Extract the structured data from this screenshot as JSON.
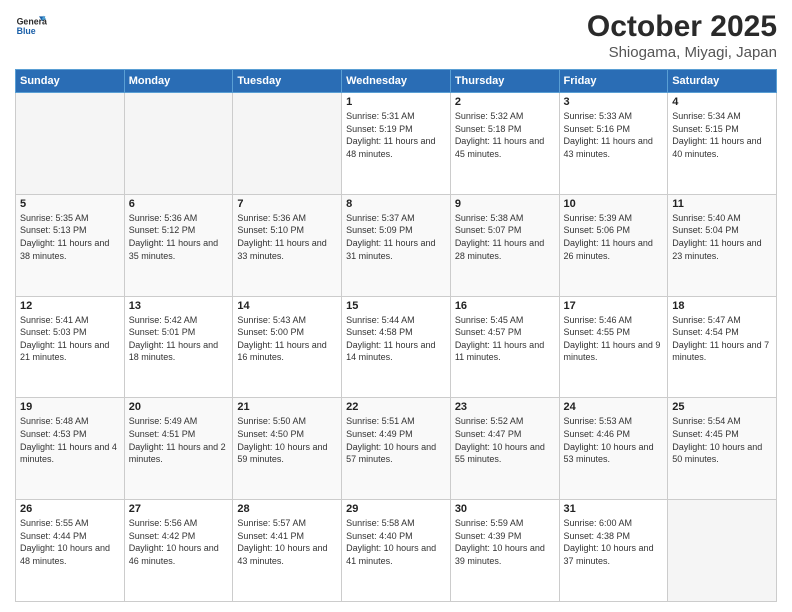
{
  "header": {
    "logo_general": "General",
    "logo_blue": "Blue",
    "month": "October 2025",
    "location": "Shiogama, Miyagi, Japan"
  },
  "weekdays": [
    "Sunday",
    "Monday",
    "Tuesday",
    "Wednesday",
    "Thursday",
    "Friday",
    "Saturday"
  ],
  "weeks": [
    [
      {
        "day": "",
        "empty": true
      },
      {
        "day": "",
        "empty": true
      },
      {
        "day": "",
        "empty": true
      },
      {
        "day": "1",
        "sunrise": "5:31 AM",
        "sunset": "5:19 PM",
        "daylight": "11 hours and 48 minutes."
      },
      {
        "day": "2",
        "sunrise": "5:32 AM",
        "sunset": "5:18 PM",
        "daylight": "11 hours and 45 minutes."
      },
      {
        "day": "3",
        "sunrise": "5:33 AM",
        "sunset": "5:16 PM",
        "daylight": "11 hours and 43 minutes."
      },
      {
        "day": "4",
        "sunrise": "5:34 AM",
        "sunset": "5:15 PM",
        "daylight": "11 hours and 40 minutes."
      }
    ],
    [
      {
        "day": "5",
        "sunrise": "5:35 AM",
        "sunset": "5:13 PM",
        "daylight": "11 hours and 38 minutes."
      },
      {
        "day": "6",
        "sunrise": "5:36 AM",
        "sunset": "5:12 PM",
        "daylight": "11 hours and 35 minutes."
      },
      {
        "day": "7",
        "sunrise": "5:36 AM",
        "sunset": "5:10 PM",
        "daylight": "11 hours and 33 minutes."
      },
      {
        "day": "8",
        "sunrise": "5:37 AM",
        "sunset": "5:09 PM",
        "daylight": "11 hours and 31 minutes."
      },
      {
        "day": "9",
        "sunrise": "5:38 AM",
        "sunset": "5:07 PM",
        "daylight": "11 hours and 28 minutes."
      },
      {
        "day": "10",
        "sunrise": "5:39 AM",
        "sunset": "5:06 PM",
        "daylight": "11 hours and 26 minutes."
      },
      {
        "day": "11",
        "sunrise": "5:40 AM",
        "sunset": "5:04 PM",
        "daylight": "11 hours and 23 minutes."
      }
    ],
    [
      {
        "day": "12",
        "sunrise": "5:41 AM",
        "sunset": "5:03 PM",
        "daylight": "11 hours and 21 minutes."
      },
      {
        "day": "13",
        "sunrise": "5:42 AM",
        "sunset": "5:01 PM",
        "daylight": "11 hours and 18 minutes."
      },
      {
        "day": "14",
        "sunrise": "5:43 AM",
        "sunset": "5:00 PM",
        "daylight": "11 hours and 16 minutes."
      },
      {
        "day": "15",
        "sunrise": "5:44 AM",
        "sunset": "4:58 PM",
        "daylight": "11 hours and 14 minutes."
      },
      {
        "day": "16",
        "sunrise": "5:45 AM",
        "sunset": "4:57 PM",
        "daylight": "11 hours and 11 minutes."
      },
      {
        "day": "17",
        "sunrise": "5:46 AM",
        "sunset": "4:55 PM",
        "daylight": "11 hours and 9 minutes."
      },
      {
        "day": "18",
        "sunrise": "5:47 AM",
        "sunset": "4:54 PM",
        "daylight": "11 hours and 7 minutes."
      }
    ],
    [
      {
        "day": "19",
        "sunrise": "5:48 AM",
        "sunset": "4:53 PM",
        "daylight": "11 hours and 4 minutes."
      },
      {
        "day": "20",
        "sunrise": "5:49 AM",
        "sunset": "4:51 PM",
        "daylight": "11 hours and 2 minutes."
      },
      {
        "day": "21",
        "sunrise": "5:50 AM",
        "sunset": "4:50 PM",
        "daylight": "10 hours and 59 minutes."
      },
      {
        "day": "22",
        "sunrise": "5:51 AM",
        "sunset": "4:49 PM",
        "daylight": "10 hours and 57 minutes."
      },
      {
        "day": "23",
        "sunrise": "5:52 AM",
        "sunset": "4:47 PM",
        "daylight": "10 hours and 55 minutes."
      },
      {
        "day": "24",
        "sunrise": "5:53 AM",
        "sunset": "4:46 PM",
        "daylight": "10 hours and 53 minutes."
      },
      {
        "day": "25",
        "sunrise": "5:54 AM",
        "sunset": "4:45 PM",
        "daylight": "10 hours and 50 minutes."
      }
    ],
    [
      {
        "day": "26",
        "sunrise": "5:55 AM",
        "sunset": "4:44 PM",
        "daylight": "10 hours and 48 minutes."
      },
      {
        "day": "27",
        "sunrise": "5:56 AM",
        "sunset": "4:42 PM",
        "daylight": "10 hours and 46 minutes."
      },
      {
        "day": "28",
        "sunrise": "5:57 AM",
        "sunset": "4:41 PM",
        "daylight": "10 hours and 43 minutes."
      },
      {
        "day": "29",
        "sunrise": "5:58 AM",
        "sunset": "4:40 PM",
        "daylight": "10 hours and 41 minutes."
      },
      {
        "day": "30",
        "sunrise": "5:59 AM",
        "sunset": "4:39 PM",
        "daylight": "10 hours and 39 minutes."
      },
      {
        "day": "31",
        "sunrise": "6:00 AM",
        "sunset": "4:38 PM",
        "daylight": "10 hours and 37 minutes."
      },
      {
        "day": "",
        "empty": true
      }
    ]
  ]
}
